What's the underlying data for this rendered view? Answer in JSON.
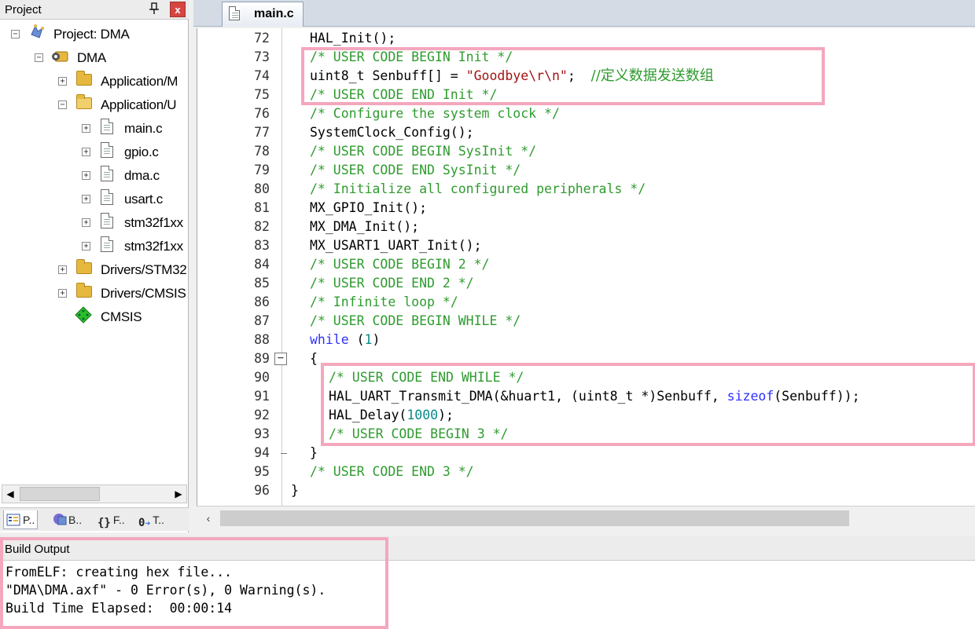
{
  "project_pane": {
    "title": "Project",
    "pin_glyph": "⬇",
    "close_glyph": "x",
    "tree": [
      {
        "label": "Project: DMA",
        "icon": "project-icon",
        "expander": "−"
      },
      {
        "label": "DMA",
        "icon": "target-icon",
        "expander": "−"
      },
      {
        "label": "Application/M",
        "icon": "folder-icon",
        "expander": "+"
      },
      {
        "label": "Application/U",
        "icon": "folder-open-icon",
        "expander": "−"
      },
      {
        "label": "main.c",
        "icon": "file-icon",
        "expander": "+"
      },
      {
        "label": "gpio.c",
        "icon": "file-icon",
        "expander": "+"
      },
      {
        "label": "dma.c",
        "icon": "file-icon",
        "expander": "+"
      },
      {
        "label": "usart.c",
        "icon": "file-icon",
        "expander": "+"
      },
      {
        "label": "stm32f1xx",
        "icon": "file-icon",
        "expander": "+"
      },
      {
        "label": "stm32f1xx",
        "icon": "file-icon",
        "expander": "+"
      },
      {
        "label": "Drivers/STM32",
        "icon": "folder-icon",
        "expander": "+"
      },
      {
        "label": "Drivers/CMSIS",
        "icon": "folder-icon",
        "expander": "+"
      },
      {
        "label": "CMSIS",
        "icon": "cmsis-icon",
        "expander": ""
      }
    ],
    "tabs": [
      {
        "label": "P..",
        "icon": "project-tab-icon"
      },
      {
        "label": "B..",
        "icon": "books-tab-icon"
      },
      {
        "label": "F..",
        "icon": "functions-tab-icon"
      },
      {
        "label": "T..",
        "icon": "templates-tab-icon"
      }
    ]
  },
  "editor": {
    "active_tab": "main.c",
    "lines": [
      {
        "n": "72",
        "text": "HAL_Init();"
      },
      {
        "n": "73",
        "text": "/* USER CODE BEGIN Init */"
      },
      {
        "n": "74",
        "text": "uint8_t Senbuff[] = \"Goodbye\\r\\n\";  //定义数据发送数组"
      },
      {
        "n": "75",
        "text": "/* USER CODE END Init */"
      },
      {
        "n": "76",
        "text": "/* Configure the system clock */"
      },
      {
        "n": "77",
        "text": "SystemClock_Config();"
      },
      {
        "n": "78",
        "text": "/* USER CODE BEGIN SysInit */"
      },
      {
        "n": "79",
        "text": "/* USER CODE END SysInit */"
      },
      {
        "n": "80",
        "text": "/* Initialize all configured peripherals */"
      },
      {
        "n": "81",
        "text": "MX_GPIO_Init();"
      },
      {
        "n": "82",
        "text": "MX_DMA_Init();"
      },
      {
        "n": "83",
        "text": "MX_USART1_UART_Init();"
      },
      {
        "n": "84",
        "text": "/* USER CODE BEGIN 2 */"
      },
      {
        "n": "85",
        "text": "/* USER CODE END 2 */"
      },
      {
        "n": "86",
        "text": "/* Infinite loop */"
      },
      {
        "n": "87",
        "text": "/* USER CODE BEGIN WHILE */"
      },
      {
        "n": "88",
        "text": "while (1)"
      },
      {
        "n": "89",
        "text": "{"
      },
      {
        "n": "90",
        "text": "/* USER CODE END WHILE */"
      },
      {
        "n": "91",
        "text": "HAL_UART_Transmit_DMA(&huart1, (uint8_t *)Senbuff, sizeof(Senbuff));"
      },
      {
        "n": "92",
        "text": "HAL_Delay(1000);"
      },
      {
        "n": "93",
        "text": "/* USER CODE BEGIN 3 */"
      },
      {
        "n": "94",
        "text": "}"
      },
      {
        "n": "95",
        "text": "/* USER CODE END 3 */"
      },
      {
        "n": "96",
        "text": "}"
      }
    ],
    "colors": {
      "comment": "#2f9b2f",
      "keyword": "#3030ff",
      "string": "#a31515",
      "number": "#0a8a8a",
      "highlight": "#f4a7bd"
    }
  },
  "build_output": {
    "title": "Build Output",
    "lines": [
      "FromELF: creating hex file...",
      "\"DMA\\DMA.axf\" - 0 Error(s), 0 Warning(s).",
      "Build Time Elapsed:  00:00:14"
    ]
  }
}
